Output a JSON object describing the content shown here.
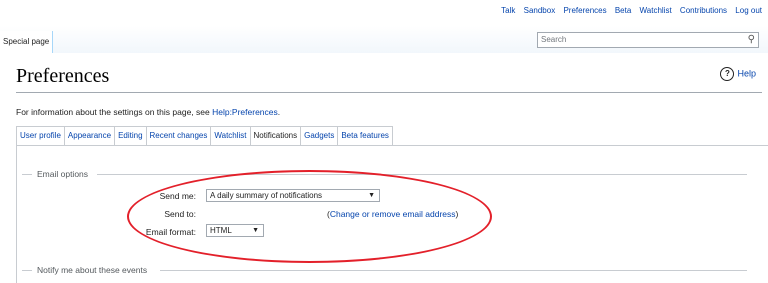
{
  "personal_tools": [
    "Talk",
    "Sandbox",
    "Preferences",
    "Beta",
    "Watchlist",
    "Contributions",
    "Log out"
  ],
  "header": {
    "tab_special": "Special page",
    "search_placeholder": "Search"
  },
  "page": {
    "title": "Preferences",
    "help": "Help",
    "intro_text": "For information about the settings on this page, see ",
    "intro_link": "Help:Preferences",
    "intro_end": "."
  },
  "tabs": [
    {
      "label": "User profile",
      "active": false
    },
    {
      "label": "Appearance",
      "active": false
    },
    {
      "label": "Editing",
      "active": false
    },
    {
      "label": "Recent changes",
      "active": false
    },
    {
      "label": "Watchlist",
      "active": false
    },
    {
      "label": "Notifications",
      "active": true
    },
    {
      "label": "Gadgets",
      "active": false
    },
    {
      "label": "Beta features",
      "active": false
    }
  ],
  "email_options": {
    "legend": "Email options",
    "send_me_label": "Send me:",
    "send_me_value": "A daily summary of notifications",
    "send_to_label": "Send to:",
    "send_to_value": "",
    "change_link": "Change or remove email address",
    "format_label": "Email format:",
    "format_value": "HTML"
  },
  "notify": {
    "legend": "Notify me about these events"
  },
  "colors": {
    "link": "#0645ad",
    "annotation": "#e3202a"
  }
}
